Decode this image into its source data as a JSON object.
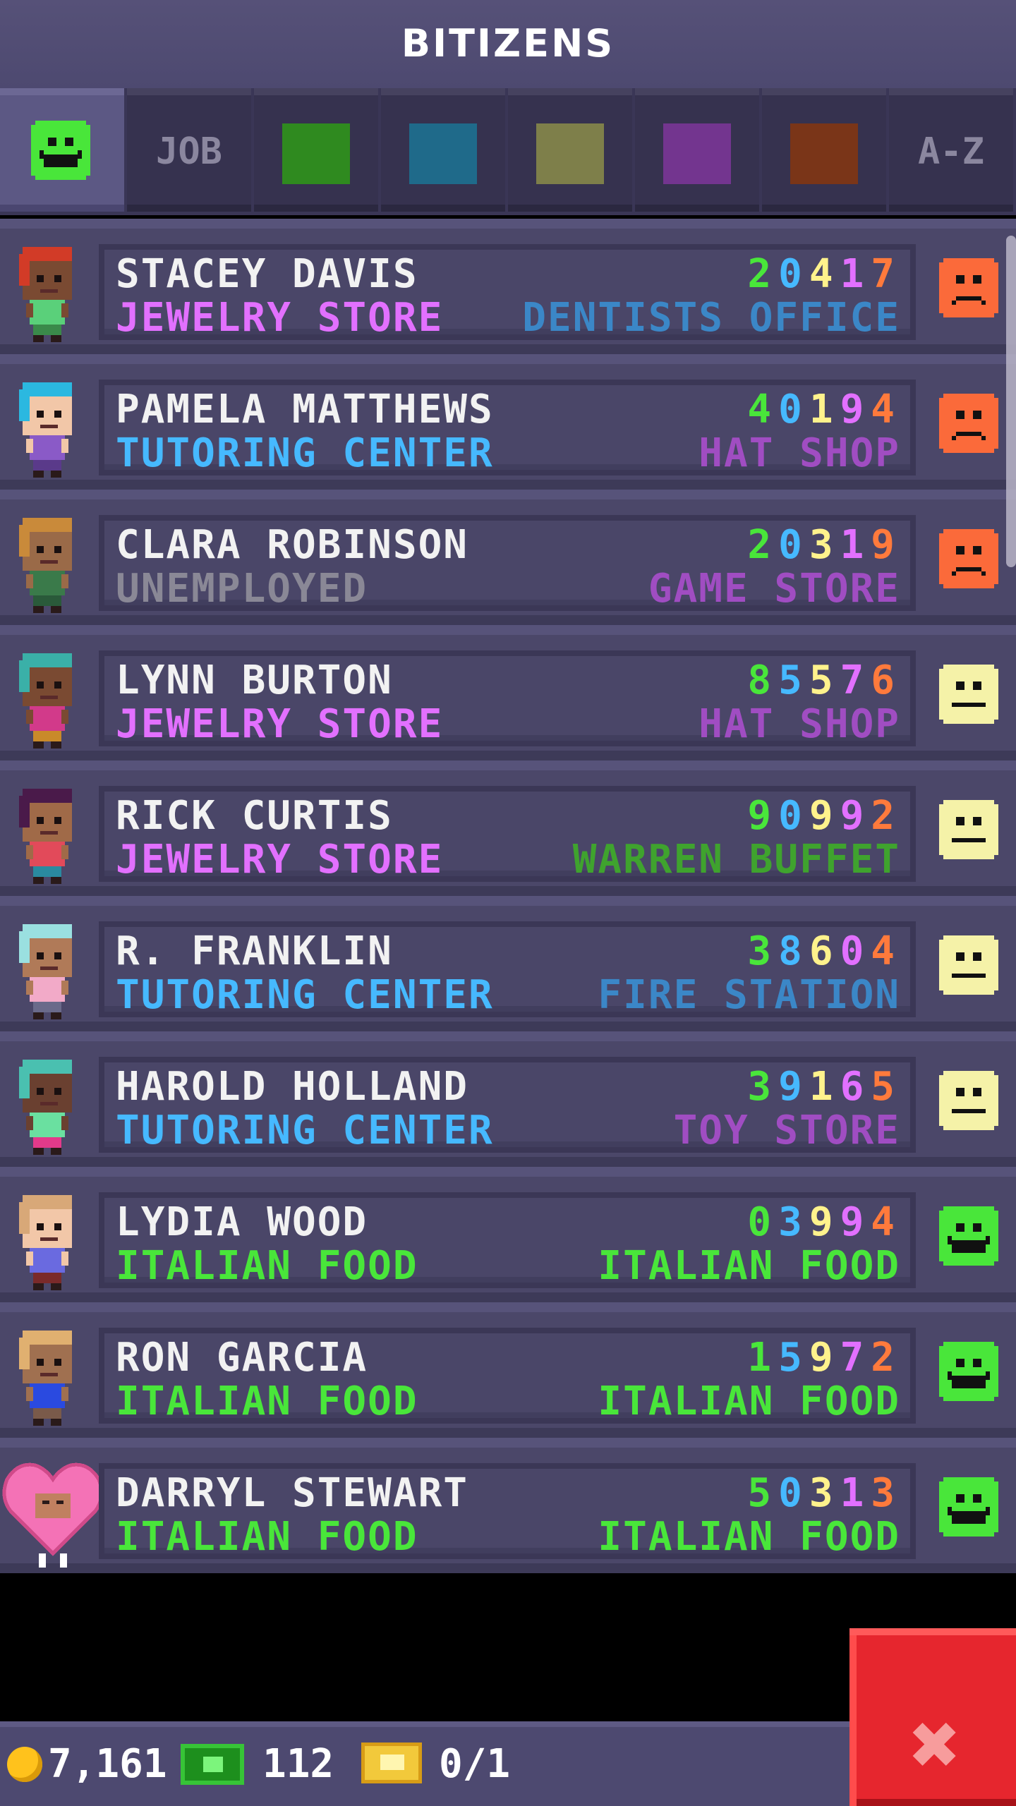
{
  "header": {
    "title": "BITIZENS"
  },
  "tabs": [
    {
      "kind": "face",
      "name": "tab-happiness",
      "color": "#49e63a"
    },
    {
      "kind": "label",
      "name": "tab-job",
      "label": "JOB"
    },
    {
      "kind": "swatch",
      "name": "tab-food",
      "color": "#2f8a1f"
    },
    {
      "kind": "swatch",
      "name": "tab-service",
      "color": "#1f6a8a"
    },
    {
      "kind": "swatch",
      "name": "tab-recreation",
      "color": "#7e7f4a"
    },
    {
      "kind": "swatch",
      "name": "tab-retail",
      "color": "#73358f"
    },
    {
      "kind": "swatch",
      "name": "tab-creative",
      "color": "#7a3518"
    },
    {
      "kind": "label",
      "name": "tab-a-z",
      "label": "A-Z"
    }
  ],
  "colors": {
    "digits": [
      "#49e63a",
      "#46b9ff",
      "#fff28c",
      "#e270ff",
      "#ff7a3c"
    ],
    "retail": "#e270ff",
    "service": "#46b9ff",
    "food": "#49e63a",
    "unemployed": "#8a8896",
    "dream_service": "#3b87c7",
    "dream_retail": "#a04dc2",
    "dream_food": "#3fa32e"
  },
  "citizens": [
    {
      "name": "STACEY DAVIS",
      "job": "JEWELRY STORE",
      "job_color": "#e270ff",
      "dream": "DENTISTS OFFICE",
      "dream_color": "#3b87c7",
      "digits": [
        "2",
        "0",
        "4",
        "1",
        "7"
      ],
      "mood": "sad"
    },
    {
      "name": "PAMELA MATTHEWS",
      "job": "TUTORING CENTER",
      "job_color": "#46b9ff",
      "dream": "HAT SHOP",
      "dream_color": "#a04dc2",
      "digits": [
        "4",
        "0",
        "1",
        "9",
        "4"
      ],
      "mood": "sad"
    },
    {
      "name": "CLARA ROBINSON",
      "job": "UNEMPLOYED",
      "job_color": "#8a8896",
      "dream": "GAME STORE",
      "dream_color": "#a04dc2",
      "digits": [
        "2",
        "0",
        "3",
        "1",
        "9"
      ],
      "mood": "sad"
    },
    {
      "name": "LYNN BURTON",
      "job": "JEWELRY STORE",
      "job_color": "#e270ff",
      "dream": "HAT SHOP",
      "dream_color": "#a04dc2",
      "digits": [
        "8",
        "5",
        "5",
        "7",
        "6"
      ],
      "mood": "neutral"
    },
    {
      "name": "RICK CURTIS",
      "job": "JEWELRY STORE",
      "job_color": "#e270ff",
      "dream": "WARREN BUFFET",
      "dream_color": "#3fa32e",
      "digits": [
        "9",
        "0",
        "9",
        "9",
        "2"
      ],
      "mood": "neutral"
    },
    {
      "name": "R. FRANKLIN",
      "job": "TUTORING CENTER",
      "job_color": "#46b9ff",
      "dream": "FIRE STATION",
      "dream_color": "#3b87c7",
      "digits": [
        "3",
        "8",
        "6",
        "0",
        "4"
      ],
      "mood": "neutral"
    },
    {
      "name": "HAROLD HOLLAND",
      "job": "TUTORING CENTER",
      "job_color": "#46b9ff",
      "dream": "TOY STORE",
      "dream_color": "#a04dc2",
      "digits": [
        "3",
        "9",
        "1",
        "6",
        "5"
      ],
      "mood": "neutral"
    },
    {
      "name": "LYDIA WOOD",
      "job": "ITALIAN FOOD",
      "job_color": "#49e63a",
      "dream": "ITALIAN FOOD",
      "dream_color": "#49e63a",
      "digits": [
        "0",
        "3",
        "9",
        "9",
        "4"
      ],
      "mood": "happy"
    },
    {
      "name": "RON GARCIA",
      "job": "ITALIAN FOOD",
      "job_color": "#49e63a",
      "dream": "ITALIAN FOOD",
      "dream_color": "#49e63a",
      "digits": [
        "1",
        "5",
        "9",
        "7",
        "2"
      ],
      "mood": "happy"
    },
    {
      "name": "DARRYL STEWART",
      "job": "ITALIAN FOOD",
      "job_color": "#49e63a",
      "dream": "ITALIAN FOOD",
      "dream_color": "#49e63a",
      "digits": [
        "5",
        "0",
        "3",
        "1",
        "3"
      ],
      "mood": "happy"
    }
  ],
  "avatars": [
    {
      "hair": "#d23b27",
      "skin": "#7a4a32",
      "shirt": "#5ad07a",
      "pants": "#3a8a4a",
      "heart": false
    },
    {
      "hair": "#2bb8e0",
      "skin": "#f2c7a8",
      "shirt": "#8a5ac7",
      "pants": "#5a3a8a",
      "heart": false
    },
    {
      "hair": "#c98a3a",
      "skin": "#9a6a48",
      "shirt": "#3a7a4a",
      "pants": "#2a5a3a",
      "heart": false
    },
    {
      "hair": "#3ab0a8",
      "skin": "#7a4a32",
      "shirt": "#d23a8a",
      "pants": "#c98a2a",
      "heart": false
    },
    {
      "hair": "#4a1a4a",
      "skin": "#a06a48",
      "shirt": "#e24a5a",
      "pants": "#2a8aa0",
      "heart": false
    },
    {
      "hair": "#9ae0e0",
      "skin": "#b07a58",
      "shirt": "#f2aac8",
      "pants": "#6a6a8a",
      "heart": false
    },
    {
      "hair": "#4ac0b0",
      "skin": "#6a4030",
      "shirt": "#6ae0a0",
      "pants": "#e23a8a",
      "heart": false
    },
    {
      "hair": "#d8a878",
      "skin": "#f2c7a8",
      "shirt": "#6a6ae0",
      "pants": "#7a2a2a",
      "heart": false
    },
    {
      "hair": "#e0b070",
      "skin": "#a07050",
      "shirt": "#2a4ae0",
      "pants": "#7a5a4a",
      "heart": false
    },
    {
      "hair": "#f472b6",
      "skin": "#c08060",
      "shirt": "#f472b6",
      "pants": "#ffffff",
      "heart": true
    }
  ],
  "footer": {
    "coins": "7,161",
    "bux": "112",
    "tickets": "0/1"
  },
  "icons": {
    "coin": "coin-icon",
    "bux": "bux-icon",
    "ticket": "vip-ticket-icon",
    "close": "close-icon"
  }
}
